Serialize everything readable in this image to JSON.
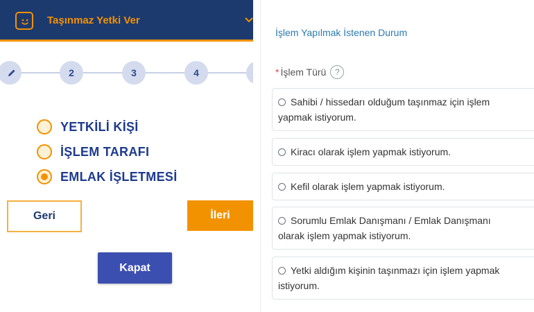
{
  "header": {
    "title": "Taşınmaz Yetki Ver"
  },
  "stepper": {
    "steps": [
      "",
      "2",
      "3",
      "4"
    ]
  },
  "role_options": [
    {
      "label": "YETKİLİ KİŞİ",
      "selected": false
    },
    {
      "label": "İŞLEM TARAFI",
      "selected": false
    },
    {
      "label": "EMLAK İŞLETMESİ",
      "selected": true
    }
  ],
  "buttons": {
    "back": "Geri",
    "next": "İleri",
    "close": "Kapat"
  },
  "form": {
    "section_title": "İşlem Yapılmak İstenen Durum",
    "required_marker": "*",
    "field_label": "İşlem Türü",
    "help_glyph": "?",
    "choices": [
      {
        "line1": "Sahibi / hissedarı olduğum taşınmaz için işlem",
        "line2": "yapmak istiyorum."
      },
      {
        "line1": "Kiracı olarak işlem yapmak istiyorum.",
        "line2": ""
      },
      {
        "line1": "Kefil olarak işlem yapmak istiyorum.",
        "line2": ""
      },
      {
        "line1": "Sorumlu Emlak Danışmanı / Emlak Danışmanı",
        "line2": "olarak işlem yapmak istiyorum."
      },
      {
        "line1": "Yetki aldığım kişinin taşınmazı için işlem yapmak",
        "line2": "istiyorum."
      }
    ]
  },
  "colors": {
    "navy": "#1d3a6e",
    "orange": "#f39200",
    "button_blue": "#3b4fb0",
    "link_blue": "#2a7ab0"
  },
  "icons": {
    "app_logo": "smiley-icon",
    "step1": "pencil-icon",
    "header_toggle": "chevron-down-icon"
  }
}
